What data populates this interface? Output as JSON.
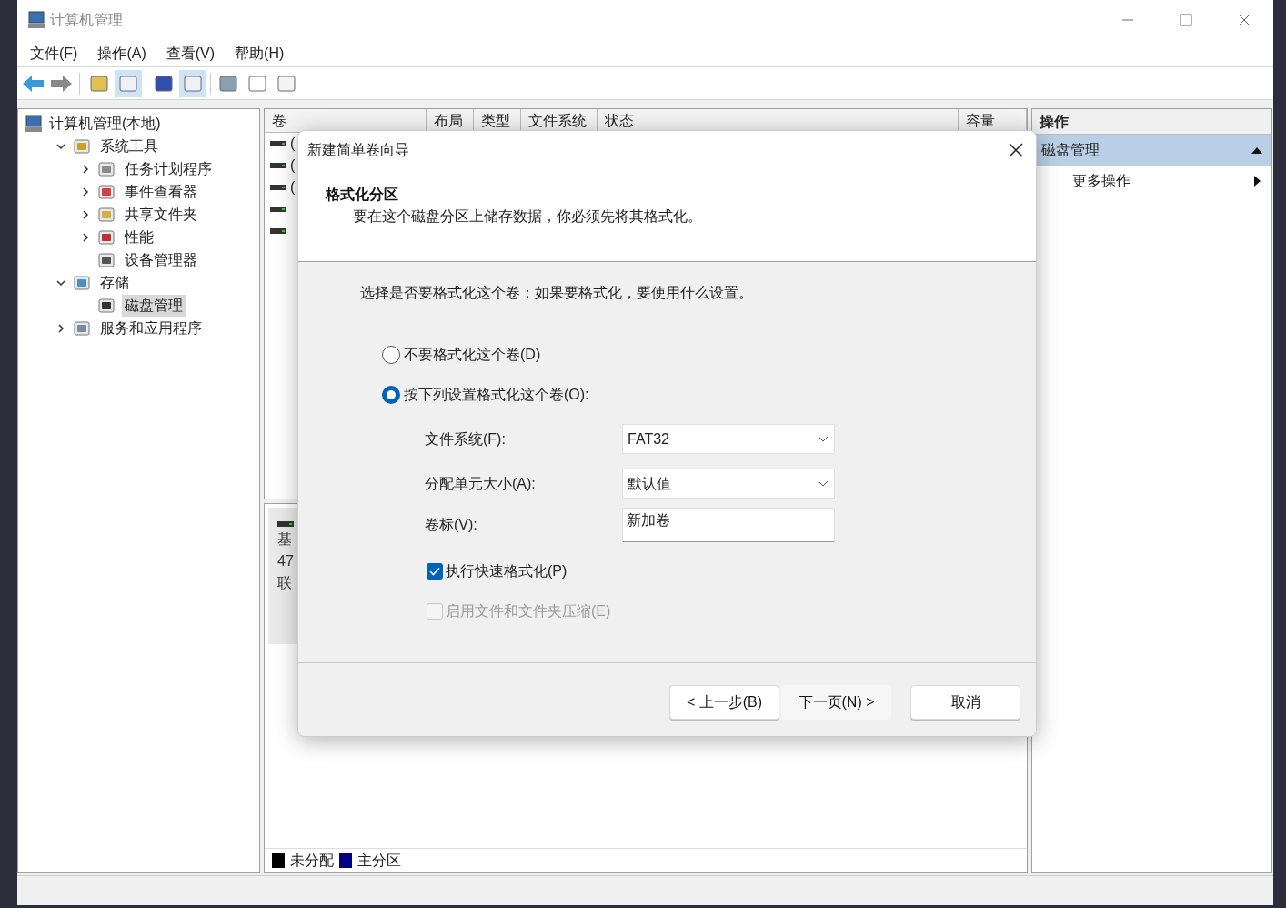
{
  "window": {
    "title": "计算机管理"
  },
  "menu": [
    "文件(F)",
    "操作(A)",
    "查看(V)",
    "帮助(H)"
  ],
  "tree": {
    "label": "计算机管理(本地)",
    "children": [
      {
        "label": "系统工具",
        "expandable": true,
        "expanded": true,
        "selected": false,
        "children": [
          {
            "label": "任务计划程序",
            "expandable": true,
            "expanded": false,
            "selected": false
          },
          {
            "label": "事件查看器",
            "expandable": true,
            "expanded": false,
            "selected": false
          },
          {
            "label": "共享文件夹",
            "expandable": true,
            "expanded": false,
            "selected": false
          },
          {
            "label": "性能",
            "expandable": true,
            "expanded": false,
            "selected": false
          },
          {
            "label": "设备管理器",
            "expandable": false,
            "selected": false
          }
        ]
      },
      {
        "label": "存储",
        "expandable": true,
        "expanded": true,
        "selected": false,
        "children": [
          {
            "label": "磁盘管理",
            "expandable": false,
            "selected": true
          }
        ]
      },
      {
        "label": "服务和应用程序",
        "expandable": true,
        "expanded": false,
        "selected": false
      }
    ]
  },
  "volume_table": {
    "columns": [
      "卷",
      "布局",
      "类型",
      "文件系统",
      "状态",
      "容量"
    ],
    "rows": [
      {
        "kind": "text",
        "column_1": "("
      },
      {
        "kind": "text",
        "column_1": "("
      },
      {
        "kind": "text",
        "column_1": "("
      },
      {
        "kind": "icon_only"
      },
      {
        "kind": "icon_only"
      }
    ]
  },
  "disk_pane": {
    "lines": [
      "基",
      "47",
      "联"
    ]
  },
  "legend": [
    {
      "label": "未分配",
      "color": "#000000"
    },
    {
      "label": "主分区",
      "color": "#000080"
    }
  ],
  "actions": {
    "header": "操作",
    "section": {
      "label": "磁盘管理",
      "expanded": true
    },
    "items": [
      "更多操作"
    ]
  },
  "dialog": {
    "title": "新建简单卷向导",
    "heading": "格式化分区",
    "subheading": "要在这个磁盘分区上储存数据，你必须先将其格式化。",
    "prompt": "选择是否要格式化这个卷；如果要格式化，要使用什么设置。",
    "radios": [
      {
        "label": "不要格式化这个卷(D)",
        "selected": false
      },
      {
        "label": "按下列设置格式化这个卷(O):",
        "selected": true
      }
    ],
    "fields": [
      {
        "kind": "select",
        "label": "文件系统(F):",
        "value": "FAT32"
      },
      {
        "kind": "select",
        "label": "分配单元大小(A):",
        "value": "默认值"
      },
      {
        "kind": "text",
        "label": "卷标(V):",
        "value": "新加卷"
      }
    ],
    "checkboxes": [
      {
        "label": "执行快速格式化(P)",
        "checked": true,
        "disabled": false
      },
      {
        "label": "启用文件和文件夹压缩(E)",
        "checked": false,
        "disabled": true
      }
    ],
    "buttons": [
      {
        "label": "< 上一步(B)",
        "focused": false
      },
      {
        "label": "下一页(N) >",
        "focused": true
      },
      {
        "label": "取消",
        "focused": false
      }
    ]
  }
}
